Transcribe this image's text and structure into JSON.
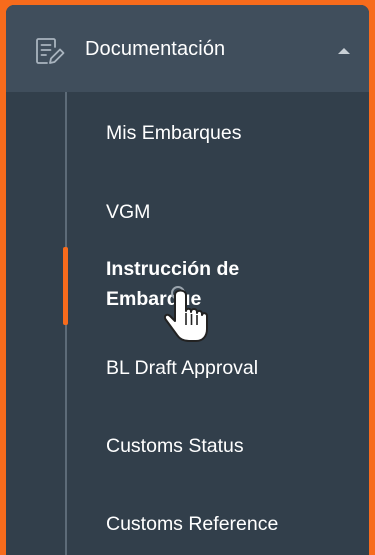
{
  "sidebar": {
    "section": {
      "label": "Documentación",
      "icon": "document-edit-icon",
      "expanded": true
    },
    "items": [
      {
        "label": "Mis Embarques",
        "active": false
      },
      {
        "label": "VGM",
        "active": false
      },
      {
        "label": "Instrucción de Embarque",
        "active": true
      },
      {
        "label": "BL Draft Approval",
        "active": false
      },
      {
        "label": "Customs Status",
        "active": false
      },
      {
        "label": "Customs Reference",
        "active": false
      }
    ]
  },
  "colors": {
    "frame_border": "#f76b1c",
    "sidebar_bg": "#323f4b",
    "header_bg": "#404e5c",
    "active_indicator": "#f76b1c",
    "text": "#ffffff"
  }
}
